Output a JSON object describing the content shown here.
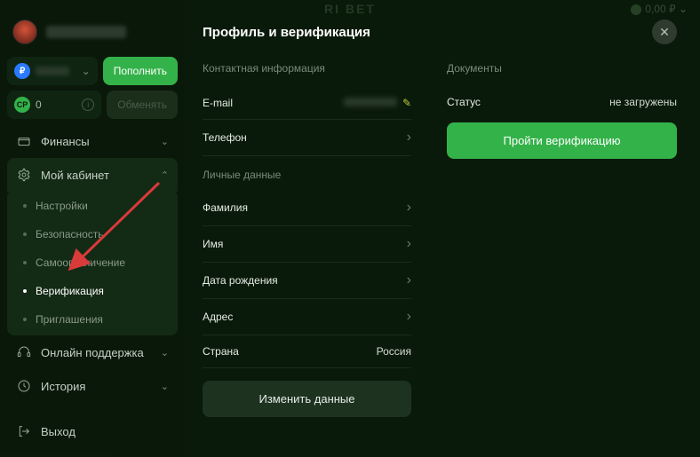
{
  "topbar": {
    "brand": "RI   BET",
    "balance": "0,00 ₽"
  },
  "sidebar": {
    "cp_value": "0",
    "deposit_label": "Пополнить",
    "exchange_label": "Обменять",
    "finances_label": "Финансы",
    "account_label": "Мой кабинет",
    "sub": {
      "settings": "Настройки",
      "security": "Безопасность",
      "selflimit": "Самоограничение",
      "verification": "Верификация",
      "invitations": "Приглашения"
    },
    "support_label": "Онлайн поддержка",
    "history_label": "История",
    "logout_label": "Выход"
  },
  "main": {
    "title": "Профиль и верификация",
    "contact_section": "Контактная информация",
    "email_label": "E-mail",
    "phone_label": "Телефон",
    "personal_section": "Личные данные",
    "lastname_label": "Фамилия",
    "firstname_label": "Имя",
    "dob_label": "Дата рождения",
    "address_label": "Адрес",
    "country_label": "Страна",
    "country_value": "Россия",
    "save_label": "Изменить данные",
    "documents_section": "Документы",
    "status_label": "Статус",
    "status_value": "не загружены",
    "verify_label": "Пройти верификацию"
  }
}
